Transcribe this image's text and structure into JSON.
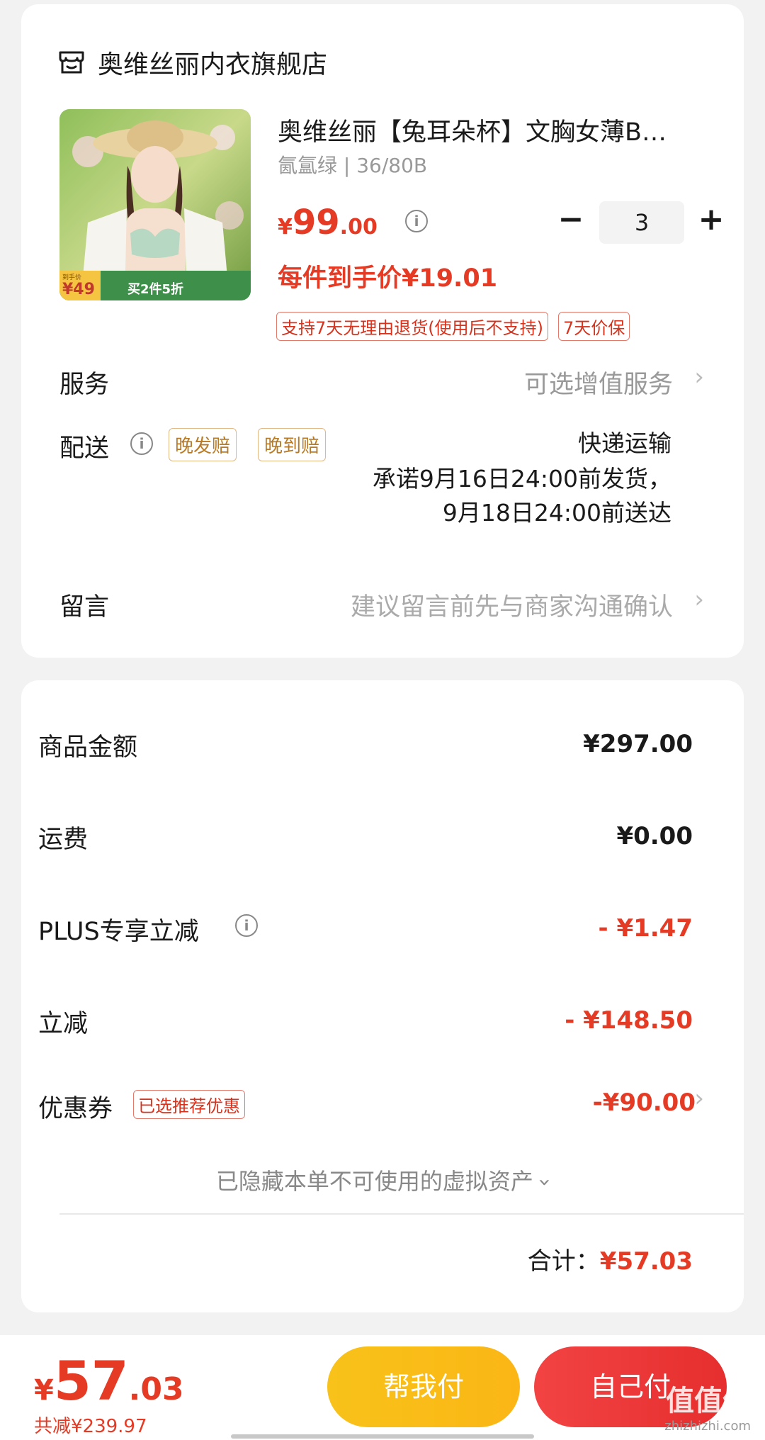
{
  "shop": {
    "name": "奥维丝丽内衣旗舰店"
  },
  "product": {
    "title": "奥维丝丽【兔耳朵杯】文胸女薄B…",
    "spec": "氤氲绿 | 36/80B",
    "price_currency": "¥",
    "price_int": "99",
    "price_dec": ".00",
    "each_price": "每件到手价¥19.01",
    "quantity": "3",
    "minus": "−",
    "plus": "+",
    "tags": [
      "支持7天无理由退货(使用后不支持)",
      "7天价保"
    ],
    "thumb_badge_price": "¥49",
    "thumb_badge_promo": "买2件5折",
    "thumb_badge_small": "到手价"
  },
  "service": {
    "label": "服务",
    "value": "可选增值服务"
  },
  "delivery": {
    "label": "配送",
    "badges": [
      "晚发赔",
      "晚到赔"
    ],
    "method": "快递运输",
    "promise_line1": "承诺9月16日24:00前发货，",
    "promise_line2": "9月18日24:00前送达"
  },
  "message": {
    "label": "留言",
    "placeholder": "建议留言前先与商家沟通确认"
  },
  "amounts": {
    "goods_label": "商品金额",
    "goods_value": "¥297.00",
    "shipping_label": "运费",
    "shipping_value": "¥0.00",
    "plus_label": "PLUS专享立减",
    "plus_value": "- ¥1.47",
    "discount_label": "立减",
    "discount_value": "- ¥148.50",
    "coupon_label": "优惠券",
    "coupon_tag": "已选推荐优惠",
    "coupon_value": "-¥90.00",
    "hidden_assets": "已隐藏本单不可使用的虚拟资产",
    "total_label": "合计：",
    "total_value": "¥57.03"
  },
  "bottom": {
    "currency": "¥",
    "int": "57",
    "dec": ".03",
    "saved": "共减¥239.97",
    "help_pay": "帮我付",
    "self_pay": "自己付",
    "watermark": "值值值",
    "watermark_url": "zhizhizhi.com"
  },
  "colors": {
    "accent_red": "#e53a24",
    "gold": "#f8c21a",
    "badge_gold": "#b77a27"
  }
}
